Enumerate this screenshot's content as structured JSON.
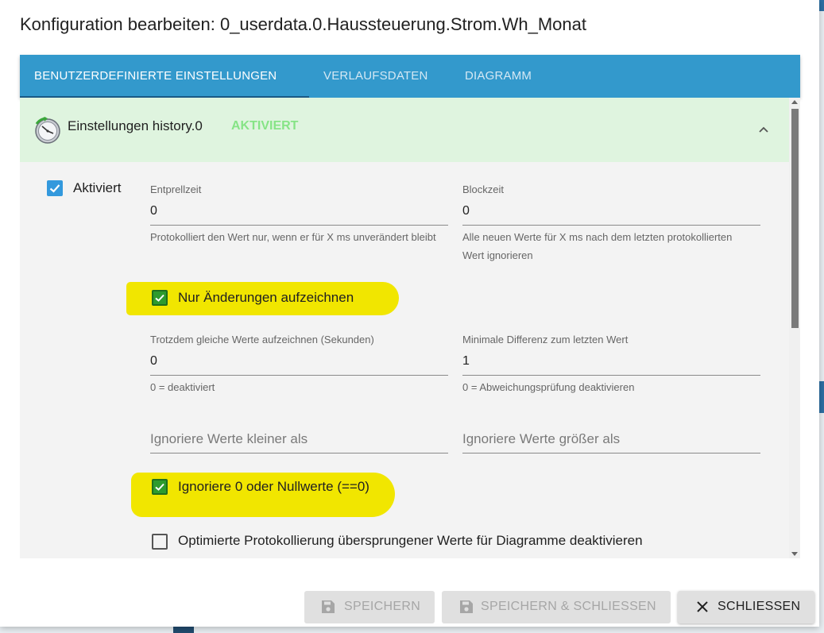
{
  "dialog": {
    "title": "Konfiguration bearbeiten: 0_userdata.0.Haussteuerung.Strom.Wh_Monat"
  },
  "tabs": [
    {
      "label": "BENUTZERDEFINIERTE EINSTELLUNGEN",
      "active": true
    },
    {
      "label": "VERLAUFSDATEN",
      "active": false
    },
    {
      "label": "DIAGRAMM",
      "active": false
    }
  ],
  "panel": {
    "icon": "history-clock-icon",
    "title": "Einstellungen history.0",
    "status": "AKTIVIERT",
    "status_color": "#86e486"
  },
  "form": {
    "enabled": {
      "label": "Aktiviert",
      "checked": true
    },
    "debounce": {
      "label": "Entprellzeit",
      "value": "0",
      "helper": "Protokolliert den Wert nur, wenn er für X ms unverändert bleibt"
    },
    "blocktime": {
      "label": "Blockzeit",
      "value": "0",
      "helper": "Alle neuen Werte für X ms nach dem letzten protokollierten Wert ignorieren"
    },
    "changes_only": {
      "label": "Nur Änderungen aufzeichnen",
      "checked": true
    },
    "change_interval": {
      "label": "Trotzdem gleiche Werte aufzeichnen (Sekunden)",
      "value": "0",
      "helper": "0 = deaktiviert"
    },
    "change_min_delta": {
      "label": "Minimale Differenz zum letzten Wert",
      "value": "1",
      "helper": "0 = Abweichungsprüfung deaktivieren"
    },
    "ignore_below": {
      "placeholder": "Ignoriere Werte kleiner als"
    },
    "ignore_above": {
      "placeholder": "Ignoriere Werte größer als"
    },
    "ignore_zero": {
      "label": "Ignoriere 0 oder Nullwerte (==0)",
      "checked": true
    },
    "disable_skipped": {
      "label": "Optimierte Protokollierung übersprungener Werte für Diagramme deaktivieren",
      "checked": false
    }
  },
  "buttons": {
    "save": {
      "label": "SPEICHERN",
      "icon": "save-icon",
      "enabled": false
    },
    "save_close": {
      "label": "SPEICHERN & SCHLIESSEN",
      "icon": "save-icon",
      "enabled": false
    },
    "close": {
      "label": "SCHLIESSEN",
      "icon": "close-icon",
      "enabled": true
    }
  },
  "colors": {
    "tab_bar": "#3399cc",
    "panel_header": "#dff4df",
    "highlight": "#f1e600",
    "checkbox_blue": "#3399dd",
    "checkbox_green": "#2e9b2e"
  }
}
